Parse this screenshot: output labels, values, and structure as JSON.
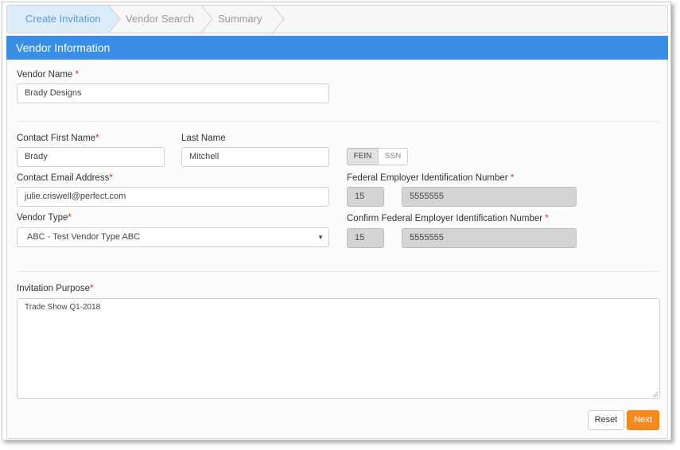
{
  "wizard": {
    "steps": [
      {
        "label": "Create Invitation",
        "state": "active"
      },
      {
        "label": "Vendor Search",
        "state": "inactive"
      },
      {
        "label": "Summary",
        "state": "inactive"
      }
    ]
  },
  "panel": {
    "title": "Vendor Information"
  },
  "form": {
    "vendor_name": {
      "label": "Vendor Name",
      "required": "*",
      "value": "Brady Designs"
    },
    "contact_first_name": {
      "label": "Contact First Name",
      "required": "*",
      "value": "Brady"
    },
    "last_name": {
      "label": "Last Name",
      "value": "Mitchell"
    },
    "tax_id_toggle": {
      "fein": "FEIN",
      "ssn": "SSN",
      "selected": "FEIN"
    },
    "contact_email": {
      "label": "Contact Email Address",
      "required": "*",
      "value": "julie.criswell@perfect.com"
    },
    "fein": {
      "label": "Federal Employer Identification Number",
      "required": "*",
      "prefix": "15",
      "number": "5555555"
    },
    "vendor_type": {
      "label": "Vendor Type",
      "required": "*",
      "value": "ABC - Test Vendor Type ABC"
    },
    "confirm_fein": {
      "label": "Confirm Federal Employer Identification Number",
      "required": "*",
      "prefix": "15",
      "number": "5555555"
    },
    "invitation_purpose": {
      "label": "Invitation Purpose",
      "required": "*",
      "value": "Trade Show Q1-2018"
    }
  },
  "actions": {
    "reset": "Reset",
    "next": "Next"
  },
  "colors": {
    "accent": "#3a8ee6",
    "next_button": "#f58a1f",
    "required": "#c9302c",
    "active_step_bg": "#dcecf8"
  }
}
